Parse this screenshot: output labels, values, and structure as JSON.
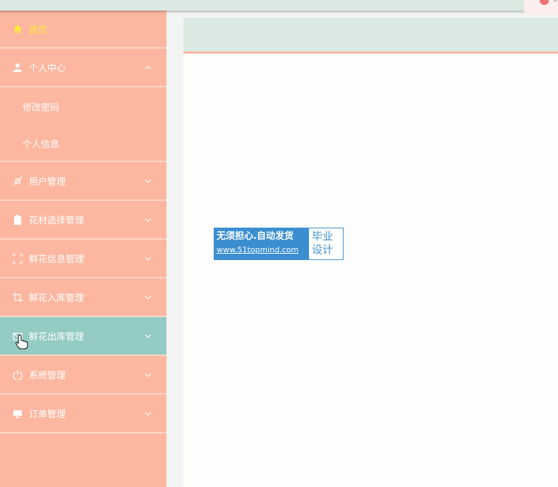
{
  "sidebar": {
    "home": {
      "label": "首页",
      "icon": "home-icon"
    },
    "personal": {
      "label": "个人中心",
      "icon": "user-icon",
      "children": [
        {
          "label": "修改密码"
        },
        {
          "label": "个人信息"
        }
      ]
    },
    "items": [
      {
        "label": "用户管理",
        "icon": "bell-off-icon"
      },
      {
        "label": "花材选择管理",
        "icon": "clipboard-icon"
      },
      {
        "label": "鲜花信息管理",
        "icon": "fullscreen-icon"
      },
      {
        "label": "鲜花入库管理",
        "icon": "crop-icon"
      },
      {
        "label": "鲜花出库管理",
        "icon": "mail-icon"
      },
      {
        "label": "系统管理",
        "icon": "power-icon"
      },
      {
        "label": "订单管理",
        "icon": "monitor-icon"
      }
    ]
  },
  "watermark": {
    "line1": "无须担心.自动发货",
    "line2": "www.51topmind.com",
    "right1": "毕业",
    "right2": "设计"
  },
  "colors": {
    "sidebar": "#fdb7a1",
    "active": "#94cbc5",
    "header": "#dbe9e3",
    "home_text": "#ffeb3b"
  }
}
